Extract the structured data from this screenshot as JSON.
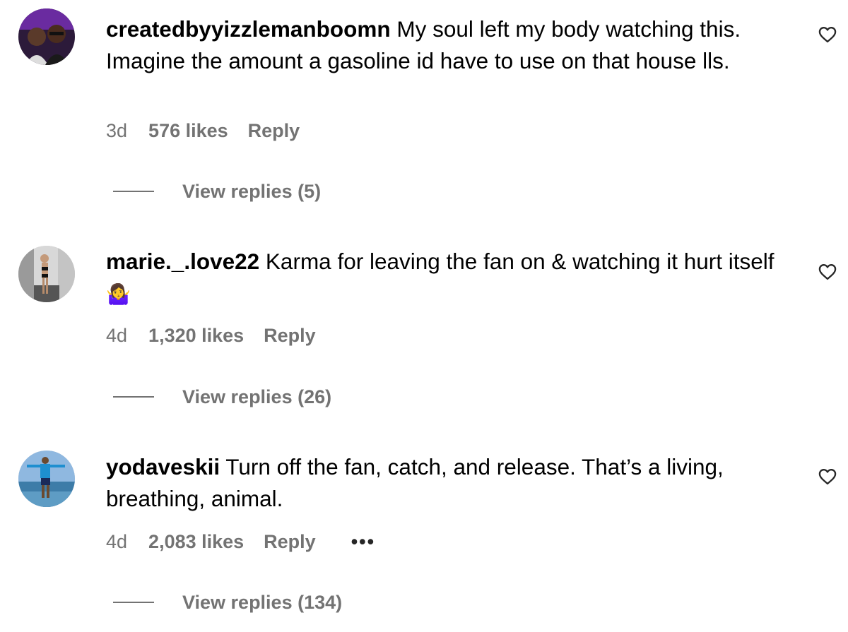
{
  "comments": [
    {
      "username": "createdbyyizzlemanboomn",
      "text": "My soul left my body watching this. Imagine the amount a gasoline id have to use on that house lls.",
      "age": "3d",
      "likes": "576 likes",
      "reply_label": "Reply",
      "view_replies": "View replies (5)"
    },
    {
      "username": "marie._.love22",
      "text": "Karma for leaving the fan on & watching it hurt itself",
      "emoji": "🤷‍♀️",
      "age": "4d",
      "likes": "1,320 likes",
      "reply_label": "Reply",
      "view_replies": "View replies (26)"
    },
    {
      "username": "yodaveskii",
      "text": "Turn off the fan, catch, and release. That’s a living, breathing, animal.",
      "age": "4d",
      "likes": "2,083 likes",
      "reply_label": "Reply",
      "more_label": "•••",
      "view_replies": "View replies (134)"
    }
  ],
  "icons": {
    "like": "heart-outline-icon",
    "more": "more-horizontal-icon"
  },
  "colors": {
    "secondary_text": "#737373",
    "primary_text": "#000000"
  }
}
